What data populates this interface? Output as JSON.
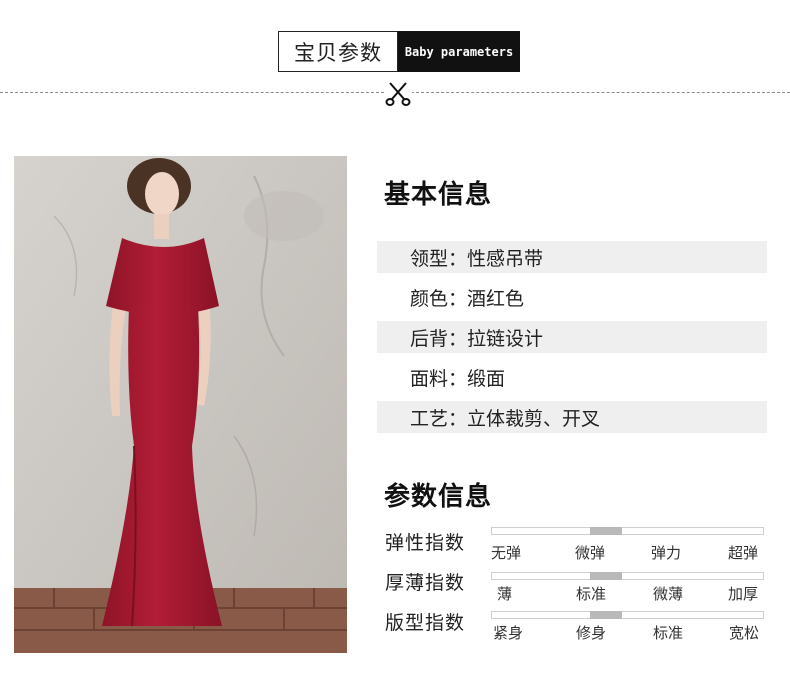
{
  "header": {
    "title_cn": "宝贝参数",
    "title_en": "Baby parameters"
  },
  "basic": {
    "title": "基本信息",
    "rows": [
      {
        "label": "领型：",
        "value": "性感吊带"
      },
      {
        "label": "颜色：",
        "value": "酒红色"
      },
      {
        "label": "后背：",
        "value": "拉链设计"
      },
      {
        "label": "面料：",
        "value": "缎面"
      },
      {
        "label": "工艺：",
        "value": "立体裁剪、开叉"
      }
    ]
  },
  "params": {
    "title": "参数信息",
    "items": [
      {
        "label": "弹性指数",
        "options": [
          "无弹",
          "微弹",
          "弹力",
          "超弹"
        ],
        "selected_index": 1
      },
      {
        "label": "厚薄指数",
        "options": [
          "薄",
          "标准",
          "微薄",
          "加厚"
        ],
        "selected_index": 1
      },
      {
        "label": "版型指数",
        "options": [
          "紧身",
          "修身",
          "标准",
          "宽松"
        ],
        "selected_index": 1
      }
    ]
  },
  "colors": {
    "dress": "#a3182f",
    "wall": "#cfcbc6",
    "floor": "#8a5a48"
  }
}
